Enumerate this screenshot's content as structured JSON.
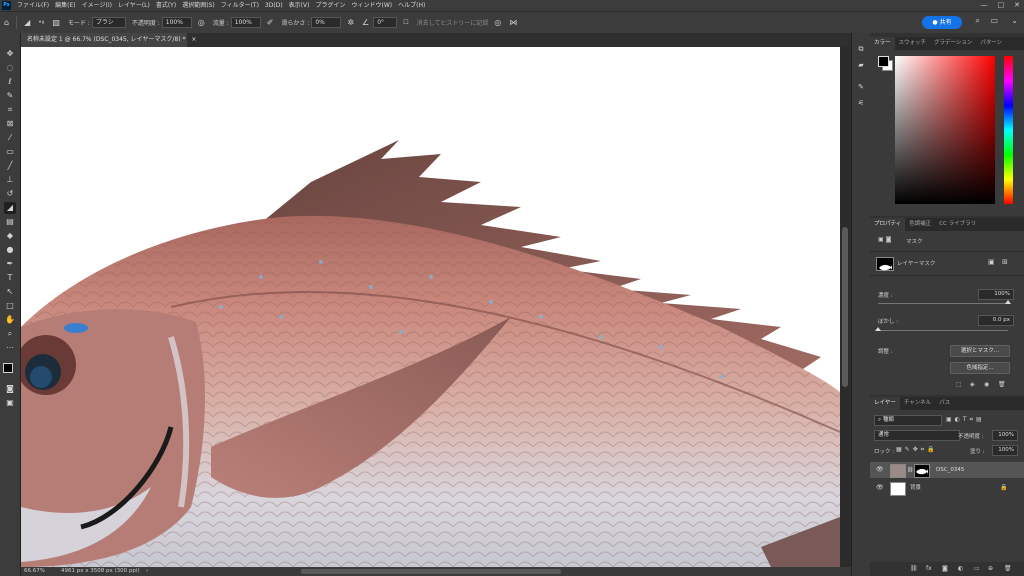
{
  "menubar": {
    "logo": "Ps",
    "items": [
      "ファイル(F)",
      "編集(E)",
      "イメージ(I)",
      "レイヤー(L)",
      "書式(Y)",
      "選択範囲(S)",
      "フィルター(T)",
      "3D(D)",
      "表示(V)",
      "プラグイン",
      "ウィンドウ(W)",
      "ヘルプ(H)"
    ],
    "window_controls": [
      "—",
      "□",
      "✕"
    ]
  },
  "options": {
    "brush_size": "9",
    "mode_label": "モード :",
    "mode_value": "ブラシ",
    "opacity_label": "不透明度 :",
    "opacity_value": "100%",
    "flow_label": "流量 :",
    "flow_value": "100%",
    "smoothing_label": "滑らかさ :",
    "smoothing_value": "0%",
    "angle_value": "0°",
    "history_label": "消去してヒストリーに記録",
    "share_label": "共有"
  },
  "document": {
    "tab_title": "名称未設定 1 @ 66.7% (DSC_0345, レイヤーマスク/8) *",
    "tab_close": "×"
  },
  "status": {
    "zoom": "66.67%",
    "doc_size": "4961 px x 3508 px (300 ppi)"
  },
  "color_panel": {
    "tabs": [
      "カラー",
      "スウォッチ",
      "グラデーション",
      "パターン"
    ],
    "foreground": "#000000",
    "background": "#ffffff",
    "picker_hue": "#ff0000"
  },
  "properties_panel": {
    "tabs": [
      "プロパティ",
      "色調補正",
      "CC ライブラリ"
    ],
    "mask_label": "マスク",
    "layer_mask_label": "レイヤーマスク",
    "density_label": "濃度 :",
    "density_value": "100%",
    "density_level": 1.0,
    "feather_label": "ぼかし :",
    "feather_value": "0.0 px",
    "feather_level": 0.0,
    "refine_label": "調整 :",
    "select_mask_button": "選択とマスク...",
    "color_range_button": "色域指定..."
  },
  "layers_panel": {
    "tabs": [
      "レイヤー",
      "チャンネル",
      "パス"
    ],
    "filter_label": "種類",
    "blend_mode": "通常",
    "opacity_label": "不透明度 :",
    "opacity_value": "100%",
    "lock_label": "ロック :",
    "fill_label": "塗り :",
    "fill_value": "100%",
    "layers": [
      {
        "name": "DSC_0345",
        "selected": true,
        "locked": false
      },
      {
        "name": "背景",
        "selected": false,
        "locked": true
      }
    ]
  }
}
